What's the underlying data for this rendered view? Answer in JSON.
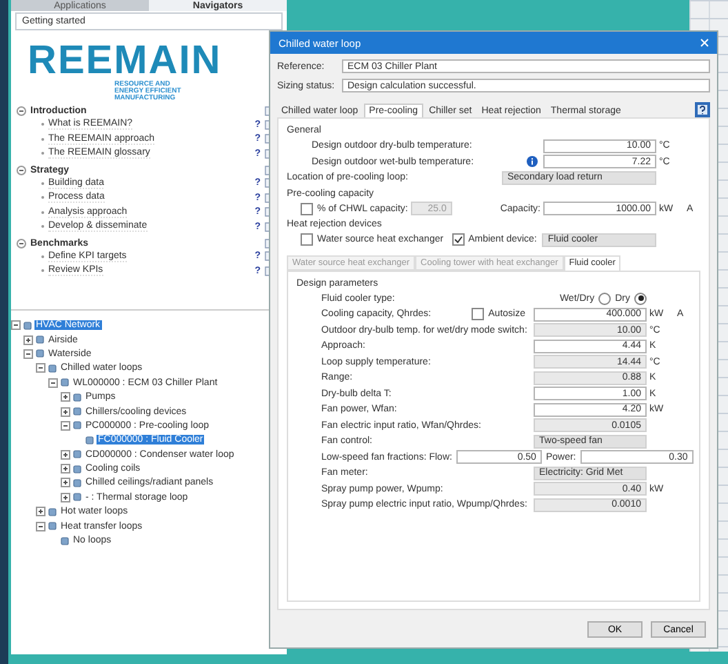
{
  "left_panel": {
    "tabs": [
      {
        "label": "Applications",
        "selected": false
      },
      {
        "label": "Navigators",
        "selected": true
      }
    ],
    "dropdown": "Getting started",
    "logo": {
      "wordmark": "REEMAIN",
      "tagline": "RESOURCE AND ENERGY EFFICIENT MANUFACTURING"
    },
    "sections": [
      {
        "title": "Introduction",
        "expanded": true,
        "items": [
          {
            "label": "What is REEMAIN?",
            "help": "?"
          },
          {
            "label": "The REEMAIN approach",
            "help": "?"
          },
          {
            "label": "The REEMAIN glossary",
            "help": "?"
          }
        ]
      },
      {
        "title": "Strategy",
        "expanded": true,
        "items": [
          {
            "label": "Building data",
            "help": "?"
          },
          {
            "label": "Process data",
            "help": "?"
          },
          {
            "label": "Analysis approach",
            "help": "?"
          },
          {
            "label": "Develop & disseminate",
            "help": "?"
          }
        ]
      },
      {
        "title": "Benchmarks",
        "expanded": true,
        "items": [
          {
            "label": "Define KPI targets",
            "help": "?"
          },
          {
            "label": "Review KPIs",
            "help": "?"
          }
        ]
      }
    ]
  },
  "tree": [
    {
      "label": "HVAC Network",
      "selected": true,
      "expanded": true,
      "children": [
        {
          "label": "Airside",
          "selected": false,
          "expanded": false
        },
        {
          "label": "Waterside",
          "selected": false,
          "expanded": true,
          "children": [
            {
              "label": "Chilled water loops",
              "selected": false,
              "expanded": true,
              "children": [
                {
                  "label": "WL000000 : ECM 03 Chiller Plant",
                  "selected": false,
                  "expanded": true,
                  "children": [
                    {
                      "label": "Pumps",
                      "selected": false,
                      "expanded": false
                    },
                    {
                      "label": "Chillers/cooling devices",
                      "selected": false,
                      "expanded": false
                    },
                    {
                      "label": "PC000000 : Pre-cooling loop",
                      "selected": false,
                      "expanded": true,
                      "children": [
                        {
                          "label": "FC000000 : Fluid Cooler",
                          "selected": true
                        }
                      ]
                    },
                    {
                      "label": "CD000000 : Condenser water loop",
                      "selected": false,
                      "expanded": false
                    },
                    {
                      "label": "Cooling coils",
                      "selected": false,
                      "expanded": false
                    },
                    {
                      "label": "Chilled ceilings/radiant panels",
                      "selected": false,
                      "expanded": false
                    },
                    {
                      "label": "- : Thermal storage loop",
                      "selected": false,
                      "expanded": false
                    }
                  ]
                }
              ]
            },
            {
              "label": "Hot water loops",
              "selected": false,
              "expanded": false
            },
            {
              "label": "Heat transfer loops",
              "selected": false,
              "expanded": true,
              "children": [
                {
                  "label": "No loops",
                  "selected": false
                }
              ]
            }
          ]
        }
      ]
    }
  ],
  "dialog": {
    "title": "Chilled water loop",
    "reference": {
      "label": "Reference:",
      "value": "ECM 03 Chiller Plant"
    },
    "sizing_status": {
      "label": "Sizing status:",
      "value": "Design calculation successful."
    },
    "tabs": [
      {
        "label": "Chilled water loop",
        "selected": false
      },
      {
        "label": "Pre-cooling",
        "selected": true
      },
      {
        "label": "Chiller set",
        "selected": false
      },
      {
        "label": "Heat rejection",
        "selected": false
      },
      {
        "label": "Thermal storage",
        "selected": false
      }
    ],
    "general": {
      "title": "General",
      "rows": [
        {
          "label": "Design outdoor dry-bulb temperature:",
          "value": "10.00",
          "unit": "°C",
          "info": false
        },
        {
          "label": "Design outdoor wet-bulb temperature:",
          "value": "7.22",
          "unit": "°C",
          "info": true
        }
      ]
    },
    "location": {
      "label": "Location of pre-cooling loop:",
      "value": "Secondary load return"
    },
    "capacity": {
      "title": "Pre-cooling capacity",
      "checkbox": {
        "label": "% of CHWL capacity:",
        "checked": false
      },
      "percent": "25.0",
      "capacity_label": "Capacity:",
      "capacity": "1000.00",
      "unit": "kW",
      "flag": "A"
    },
    "heat_rejection": {
      "title": "Heat rejection devices",
      "water_source": {
        "label": "Water source heat exchanger",
        "checked": false
      },
      "ambient": {
        "label": "Ambient device:",
        "checked": true
      },
      "device": "Fluid cooler"
    },
    "subtabs": [
      {
        "label": "Water source heat exchanger",
        "selected": false
      },
      {
        "label": "Cooling tower with heat exchanger",
        "selected": false
      },
      {
        "label": "Fluid cooler",
        "selected": true
      }
    ],
    "design": {
      "title": "Design parameters",
      "rows": [
        {
          "kind": "radio",
          "label": "Fluid cooler type:",
          "options": [
            {
              "label": "Wet/Dry",
              "selected": false
            },
            {
              "label": "Dry",
              "selected": true
            }
          ]
        },
        {
          "kind": "field",
          "label": "Cooling capacity, Qhrdes:",
          "autosize": {
            "label": "Autosize",
            "checked": false
          },
          "value": "400.000",
          "unit": "kW",
          "flag": "A",
          "readonly": false
        },
        {
          "kind": "field",
          "label": "Outdoor dry-bulb temp. for wet/dry mode switch:",
          "value": "10.00",
          "unit": "°C",
          "readonly": true
        },
        {
          "kind": "field",
          "label": "Approach:",
          "value": "4.44",
          "unit": "K",
          "readonly": false
        },
        {
          "kind": "field",
          "label": "Loop supply temperature:",
          "value": "14.44",
          "unit": "°C",
          "readonly": true
        },
        {
          "kind": "field",
          "label": "Range:",
          "value": "0.88",
          "unit": "K",
          "readonly": true
        },
        {
          "kind": "field",
          "label": "Dry-bulb delta T:",
          "value": "1.00",
          "unit": "K",
          "readonly": false
        },
        {
          "kind": "field",
          "label": "Fan power, Wfan:",
          "value": "4.20",
          "unit": "kW",
          "readonly": false
        },
        {
          "kind": "field",
          "label": "Fan electric input ratio, Wfan/Qhrdes:",
          "value": "0.0105",
          "readonly": true
        },
        {
          "kind": "select",
          "label": "Fan control:",
          "value": "Two-speed fan"
        },
        {
          "kind": "pair",
          "label": "Low-speed fan fractions:",
          "first_label": "Flow:",
          "first_value": "0.50",
          "second_label": "Power:",
          "second_value": "0.30"
        },
        {
          "kind": "select",
          "label": "Fan meter:",
          "value": "Electricity: Grid Met"
        },
        {
          "kind": "field",
          "label": "Spray pump power, Wpump:",
          "value": "0.40",
          "unit": "kW",
          "readonly": true
        },
        {
          "kind": "field",
          "label": "Spray pump electric input ratio, Wpump/Qhrdes:",
          "value": "0.0010",
          "readonly": true
        }
      ]
    },
    "buttons": [
      "OK",
      "Cancel"
    ]
  }
}
